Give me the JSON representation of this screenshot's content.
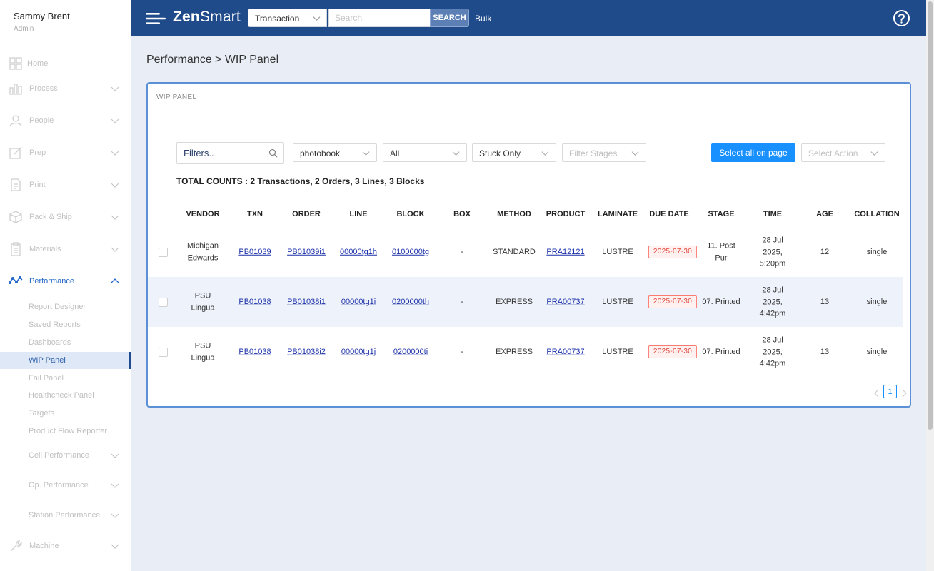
{
  "user": {
    "name": "Sammy Brent",
    "role": "Admin"
  },
  "nav": {
    "home": "Home",
    "process": "Process",
    "people": "People",
    "prep": "Prep",
    "print": "Print",
    "pack_ship": "Pack & Ship",
    "materials": "Materials",
    "performance": "Performance",
    "machine": "Machine",
    "performance_sub": [
      "Report Designer",
      "Saved Reports",
      "Dashboards",
      "WIP Panel",
      "Fail Panel",
      "Healthcheck Panel",
      "Targets",
      "Product Flow Reporter",
      "Cell Performance",
      "Op. Performance",
      "Station Performance"
    ]
  },
  "topbar": {
    "logo_bold": "Zen",
    "logo_light": "Smart",
    "search_type": "Transaction",
    "search_placeholder": "Search",
    "search_button": "SEARCH",
    "bulk": "Bulk"
  },
  "breadcrumb": "Performance > WIP Panel",
  "panel": {
    "title": "WIP PANEL",
    "filter_placeholder": "Filters..",
    "dropdowns": {
      "product": "photobook",
      "scope": "All",
      "stuck": "Stuck Only",
      "stages_placeholder": "Filter Stages",
      "action_placeholder": "Select Action"
    },
    "select_all": "Select all on page",
    "total_counts": "TOTAL COUNTS : 2 Transactions, 2 Orders, 3 Lines, 3 Blocks",
    "columns": [
      "VENDOR",
      "TXN",
      "ORDER",
      "LINE",
      "BLOCK",
      "BOX",
      "METHOD",
      "PRODUCT",
      "LAMINATE",
      "DUE DATE",
      "STAGE",
      "TIME",
      "AGE",
      "COLLATION"
    ],
    "rows": [
      {
        "vendor": [
          "Michigan",
          "Edwards"
        ],
        "txn": "PB01039",
        "order": "PB01039i1",
        "line": "00000tg1h",
        "block": "0100000tg",
        "box": "-",
        "method": "STANDARD",
        "product": "PRA12121",
        "laminate": "LUSTRE",
        "due_date": "2025-07-30",
        "stage": [
          "11. Post",
          "Pur"
        ],
        "time": [
          "28 Jul",
          "2025,",
          "5:20pm"
        ],
        "age": "12",
        "collation": "single"
      },
      {
        "vendor": [
          "PSU",
          "Lingua"
        ],
        "txn": "PB01038",
        "order": "PB01038i1",
        "line": "00000tg1i",
        "block": "0200000th",
        "box": "-",
        "method": "EXPRESS",
        "product": "PRA00737",
        "laminate": "LUSTRE",
        "due_date": "2025-07-30",
        "stage": [
          "07. Printed"
        ],
        "time": [
          "28 Jul",
          "2025,",
          "4:42pm"
        ],
        "age": "13",
        "collation": "single"
      },
      {
        "vendor": [
          "PSU",
          "Lingua"
        ],
        "txn": "PB01038",
        "order": "PB01038i2",
        "line": "00000tg1j",
        "block": "0200000ti",
        "box": "-",
        "method": "EXPRESS",
        "product": "PRA00737",
        "laminate": "LUSTRE",
        "due_date": "2025-07-30",
        "stage": [
          "07. Printed"
        ],
        "time": [
          "28 Jul",
          "2025,",
          "4:42pm"
        ],
        "age": "13",
        "collation": "single"
      }
    ],
    "pagination": {
      "current_page": "1"
    }
  },
  "colors": {
    "topbar": "#204b8a",
    "accent": "#1890ff",
    "panel_border": "#5b8fd6",
    "nav_active": "#2468c8"
  }
}
